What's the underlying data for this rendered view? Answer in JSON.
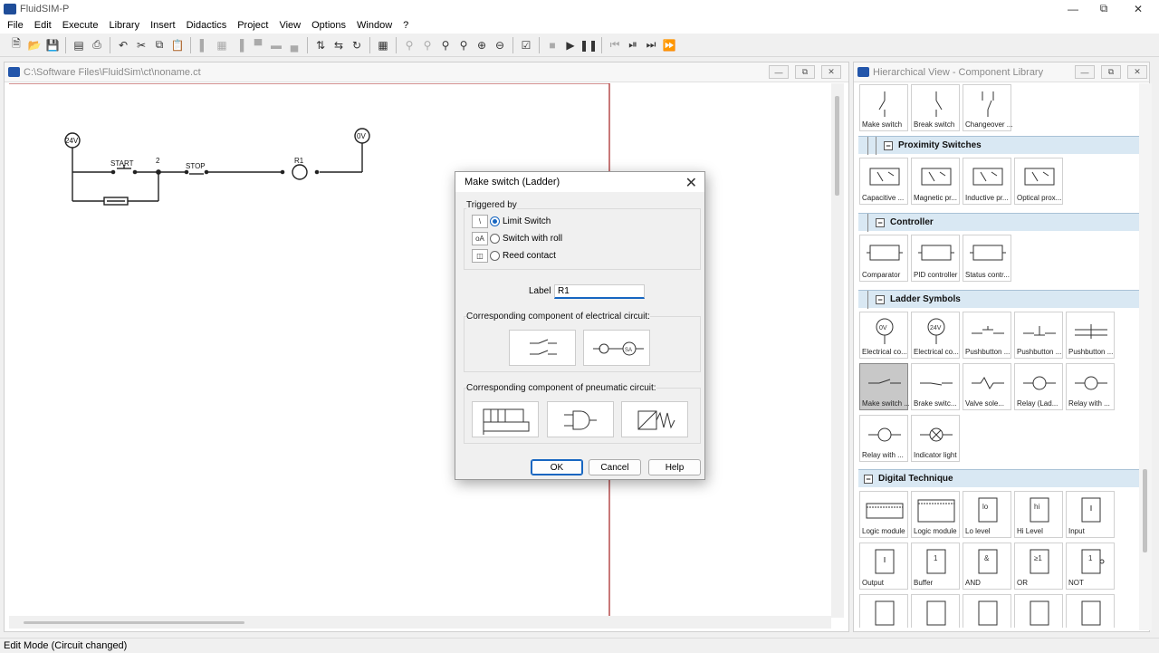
{
  "app": {
    "title": "FluidSIM-P"
  },
  "menu": [
    "File",
    "Edit",
    "Execute",
    "Library",
    "Insert",
    "Didactics",
    "Project",
    "View",
    "Options",
    "Window",
    "?"
  ],
  "circuit_window": {
    "title": "C:\\Software Files\\FluidSim\\ct\\noname.ct",
    "labels": {
      "v24": "24V",
      "v0": "0V",
      "start": "START",
      "node2": "2",
      "stop": "STOP",
      "r1": "R1"
    }
  },
  "library_window": {
    "title": "Hierarchical View - Component Library",
    "row_top": [
      "Make switch",
      "Break switch",
      "Changeover ..."
    ],
    "cat_proximity": "Proximity Switches",
    "proximity": [
      "Capacitive ...",
      "Magnetic pr...",
      "Inductive pr...",
      "Optical prox..."
    ],
    "cat_controller": "Controller",
    "controller": [
      "Comparator",
      "PID controller",
      "Status contr..."
    ],
    "cat_ladder": "Ladder Symbols",
    "ladder": [
      "Electrical co...",
      "Electrical co...",
      "Pushbutton ...",
      "Pushbutton ...",
      "Pushbutton ...",
      "Make switch ...",
      "Brake switc...",
      "Valve sole...",
      "Relay (Lad...",
      "Relay with ...",
      "Relay with ...",
      "Indicator light"
    ],
    "cat_digital": "Digital Technique",
    "digital": [
      "Logic module",
      "Logic module",
      "Lo level",
      "Hi Level",
      "Input",
      "Output",
      "Buffer",
      "AND",
      "OR",
      "NOT"
    ],
    "digital_glyphs": {
      "lo": "lo",
      "hi": "hi",
      "and": "&",
      "or": "≥1",
      "not": "1"
    }
  },
  "dialog": {
    "title": "Make switch (Ladder)",
    "triggered_by": "Triggered by",
    "options": [
      "Limit Switch",
      "Switch with roll",
      "Reed contact"
    ],
    "selected": "Limit Switch",
    "label_caption": "Label",
    "label_value": "R1",
    "electrical_caption": "Corresponding component of electrical circuit:",
    "pneumatic_caption": "Corresponding component of pneumatic circuit:",
    "relay_text": "SA",
    "ok": "OK",
    "cancel": "Cancel",
    "help": "Help"
  },
  "status": "Edit Mode (Circuit changed)"
}
